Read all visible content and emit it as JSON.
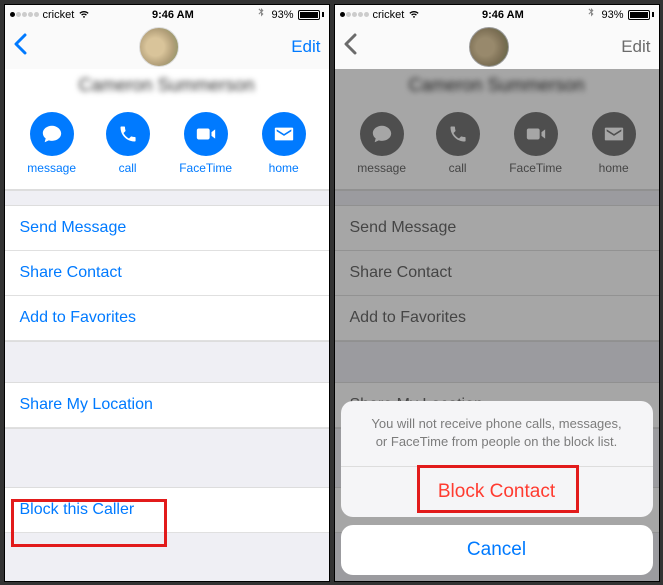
{
  "statusbar": {
    "carrier": "cricket",
    "time": "9:46 AM",
    "battery_pct": "93%"
  },
  "nav": {
    "edit": "Edit"
  },
  "contact": {
    "name": "Cameron Summerson"
  },
  "actions": {
    "message": "message",
    "call": "call",
    "facetime": "FaceTime",
    "home": "home"
  },
  "list": {
    "send_message": "Send Message",
    "share_contact": "Share Contact",
    "add_favorites": "Add to Favorites",
    "share_location": "Share My Location",
    "block_caller": "Block this Caller"
  },
  "sheet": {
    "message": "You will not receive phone calls, messages, or FaceTime from people on the block list.",
    "block": "Block Contact",
    "cancel": "Cancel"
  }
}
